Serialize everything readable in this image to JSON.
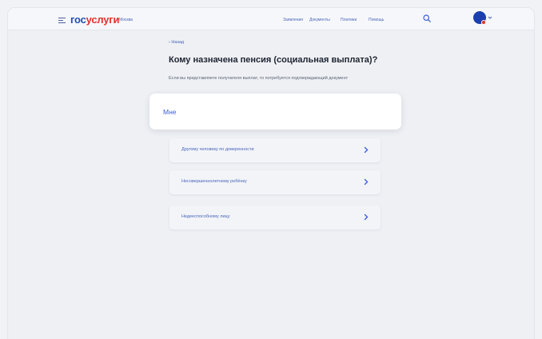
{
  "header": {
    "logo_part1": "гос",
    "logo_part2": "услуги",
    "city": "Москва",
    "nav": [
      "Заявления",
      "Документы",
      "Платежи",
      "Помощь"
    ],
    "search_icon": "search-icon",
    "menu_icon": "hamburger-icon"
  },
  "page": {
    "back_label": "‹ Назад",
    "title": "Кому назначена пенсия (социальная выплата)?",
    "subtitle": "Если вы представляете получателя выплат, то потребуется подтверждающий документ"
  },
  "options": [
    {
      "label": "Мне"
    },
    {
      "label": "Другому человеку по доверенности"
    },
    {
      "label": "Несовершеннолетнему ребёнку"
    },
    {
      "label": "Недееспособному лицу"
    }
  ],
  "colors": {
    "accent": "#3d5fd8",
    "brand_blue": "#1f4fb4",
    "brand_red": "#e4312b",
    "background": "#eef0f4"
  }
}
